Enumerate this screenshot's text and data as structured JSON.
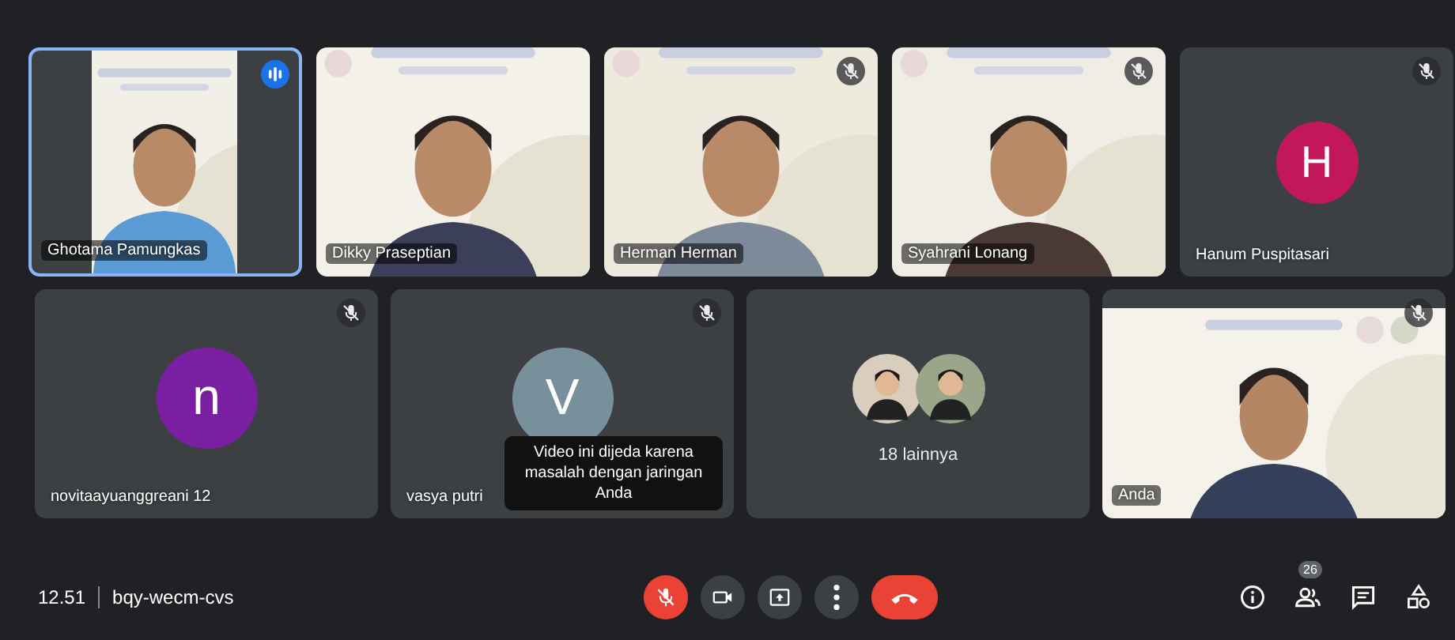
{
  "top_row": [
    {
      "kind": "video",
      "name": "Ghotama Pamungkas",
      "speaking": true,
      "muted": false
    },
    {
      "kind": "video",
      "name": "Dikky Praseptian",
      "speaking": false,
      "muted": false
    },
    {
      "kind": "video",
      "name": "Herman Herman",
      "speaking": false,
      "muted": true
    },
    {
      "kind": "video",
      "name": "Syahrani Lonang",
      "speaking": false,
      "muted": true
    },
    {
      "kind": "avatar",
      "name": "Hanum Puspitasari",
      "initial": "H",
      "color": "#c2185b",
      "speaking": false,
      "muted": true
    }
  ],
  "bottom_row": [
    {
      "kind": "avatar",
      "name": "novitaayuanggreani 12",
      "initial": "n",
      "color": "#7b1fa2",
      "speaking": false,
      "muted": true
    },
    {
      "kind": "avatar",
      "name": "vasya putri",
      "initial": "V",
      "color": "#78909c",
      "speaking": false,
      "muted": true,
      "notice": "Video ini dijeda karena masalah dengan jaringan Anda"
    },
    {
      "kind": "group",
      "label": "18 lainnya",
      "speaking": false,
      "muted": false
    },
    {
      "kind": "video",
      "name": "Anda",
      "speaking": false,
      "muted": true
    }
  ],
  "bottom_bar": {
    "time": "12.51",
    "meeting_code": "bqy-wecm-cvs",
    "mic_muted": true,
    "participant_count": "26"
  }
}
